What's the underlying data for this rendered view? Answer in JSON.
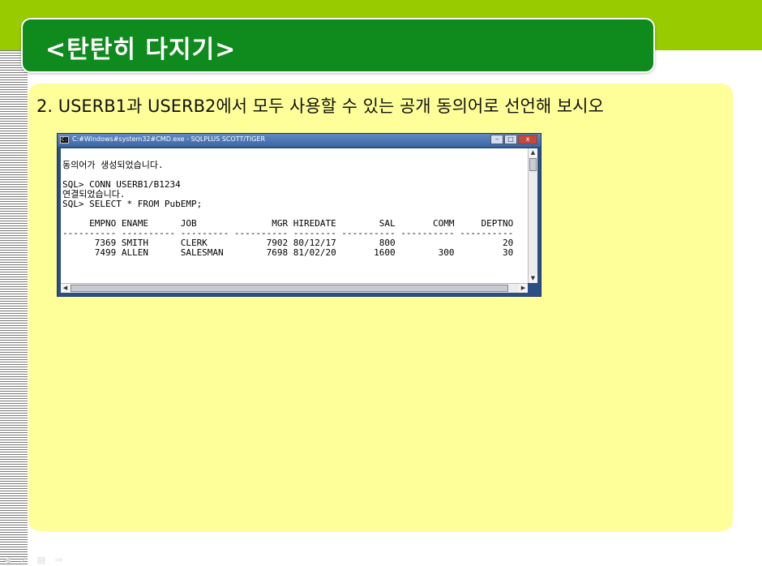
{
  "slide": {
    "title": "<탄탄히 다지기>",
    "question": "2. USERB1과 USERB2에서 모두 사용할 수 있는 공개 동의어로 선언해 보시오"
  },
  "cmd_window": {
    "title": "C:#Windows#system32#CMD.exe - SQLPLUS  SCOTT/TIGER",
    "buttons": {
      "minimize": "–",
      "maximize": "□",
      "close": "x"
    },
    "console_lines": [
      "",
      "동의어가 생성되었습니다.",
      "",
      "SQL> CONN USERB1/B1234",
      "연결되었습니다.",
      "SQL> SELECT * FROM PubEMP;",
      "",
      "     EMPNO ENAME      JOB              MGR HIREDATE        SAL       COMM     DEPTNO",
      "---------- ---------- --------- ---------- -------- ---------- ---------- ----------",
      "      7369 SMITH      CLERK           7902 80/12/17        800                    20",
      "      7499 ALLEN      SALESMAN        7698 81/02/20       1600        300         30"
    ]
  },
  "icons": {
    "cmd": "cmd-icon",
    "scroll_up": "▲",
    "scroll_down": "▼",
    "scroll_left": "◀",
    "scroll_right": "▶"
  },
  "nav_icons": [
    "◀",
    "↗",
    "▤",
    "⇨"
  ],
  "colors": {
    "top_band": "#99cc00",
    "title_box": "#0f8a1c",
    "content_bg": "#ffff99"
  }
}
